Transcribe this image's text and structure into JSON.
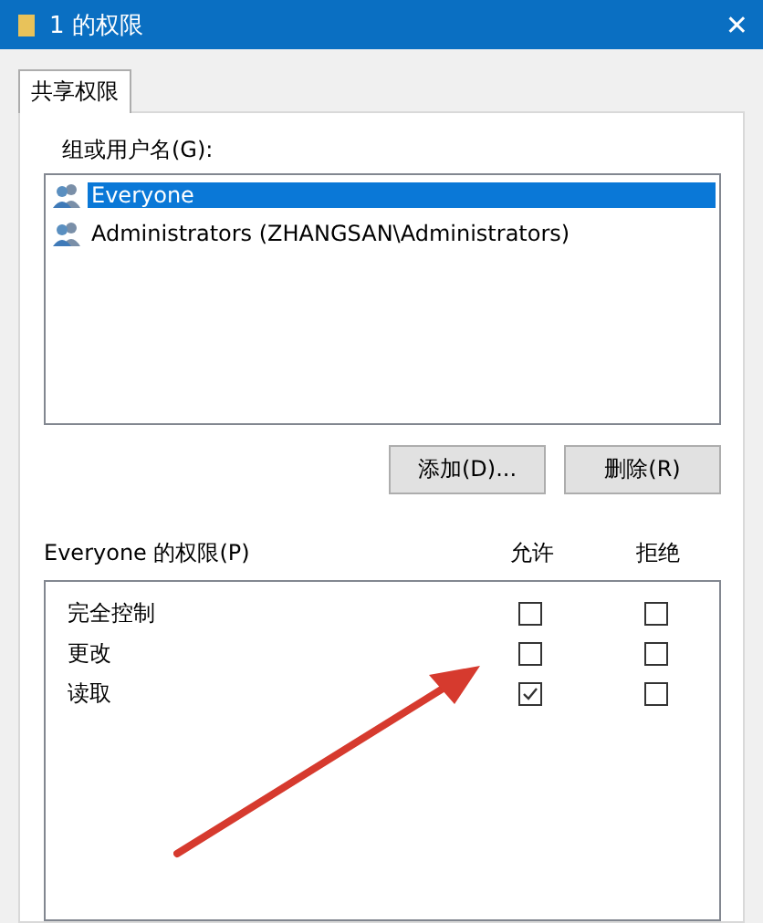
{
  "window": {
    "title": "1 的权限",
    "close": "✕"
  },
  "tabs": [
    {
      "label": "共享权限",
      "selected": true
    }
  ],
  "users": {
    "label": "组或用户名(G):",
    "items": [
      {
        "name": "Everyone",
        "selected": true
      },
      {
        "name": "Administrators (ZHANGSAN\\Administrators)",
        "selected": false
      }
    ]
  },
  "buttons": [
    "添加(D)...",
    "删除(R)"
  ],
  "permissions": {
    "label": "Everyone 的权限(P)",
    "columns": [
      "允许",
      "拒绝"
    ],
    "rows": [
      {
        "name": "完全控制",
        "allow": false,
        "deny": false
      },
      {
        "name": "更改",
        "allow": false,
        "deny": false
      },
      {
        "name": "读取",
        "allow": true,
        "deny": false
      }
    ]
  },
  "annotation": {
    "kind": "arrow"
  }
}
